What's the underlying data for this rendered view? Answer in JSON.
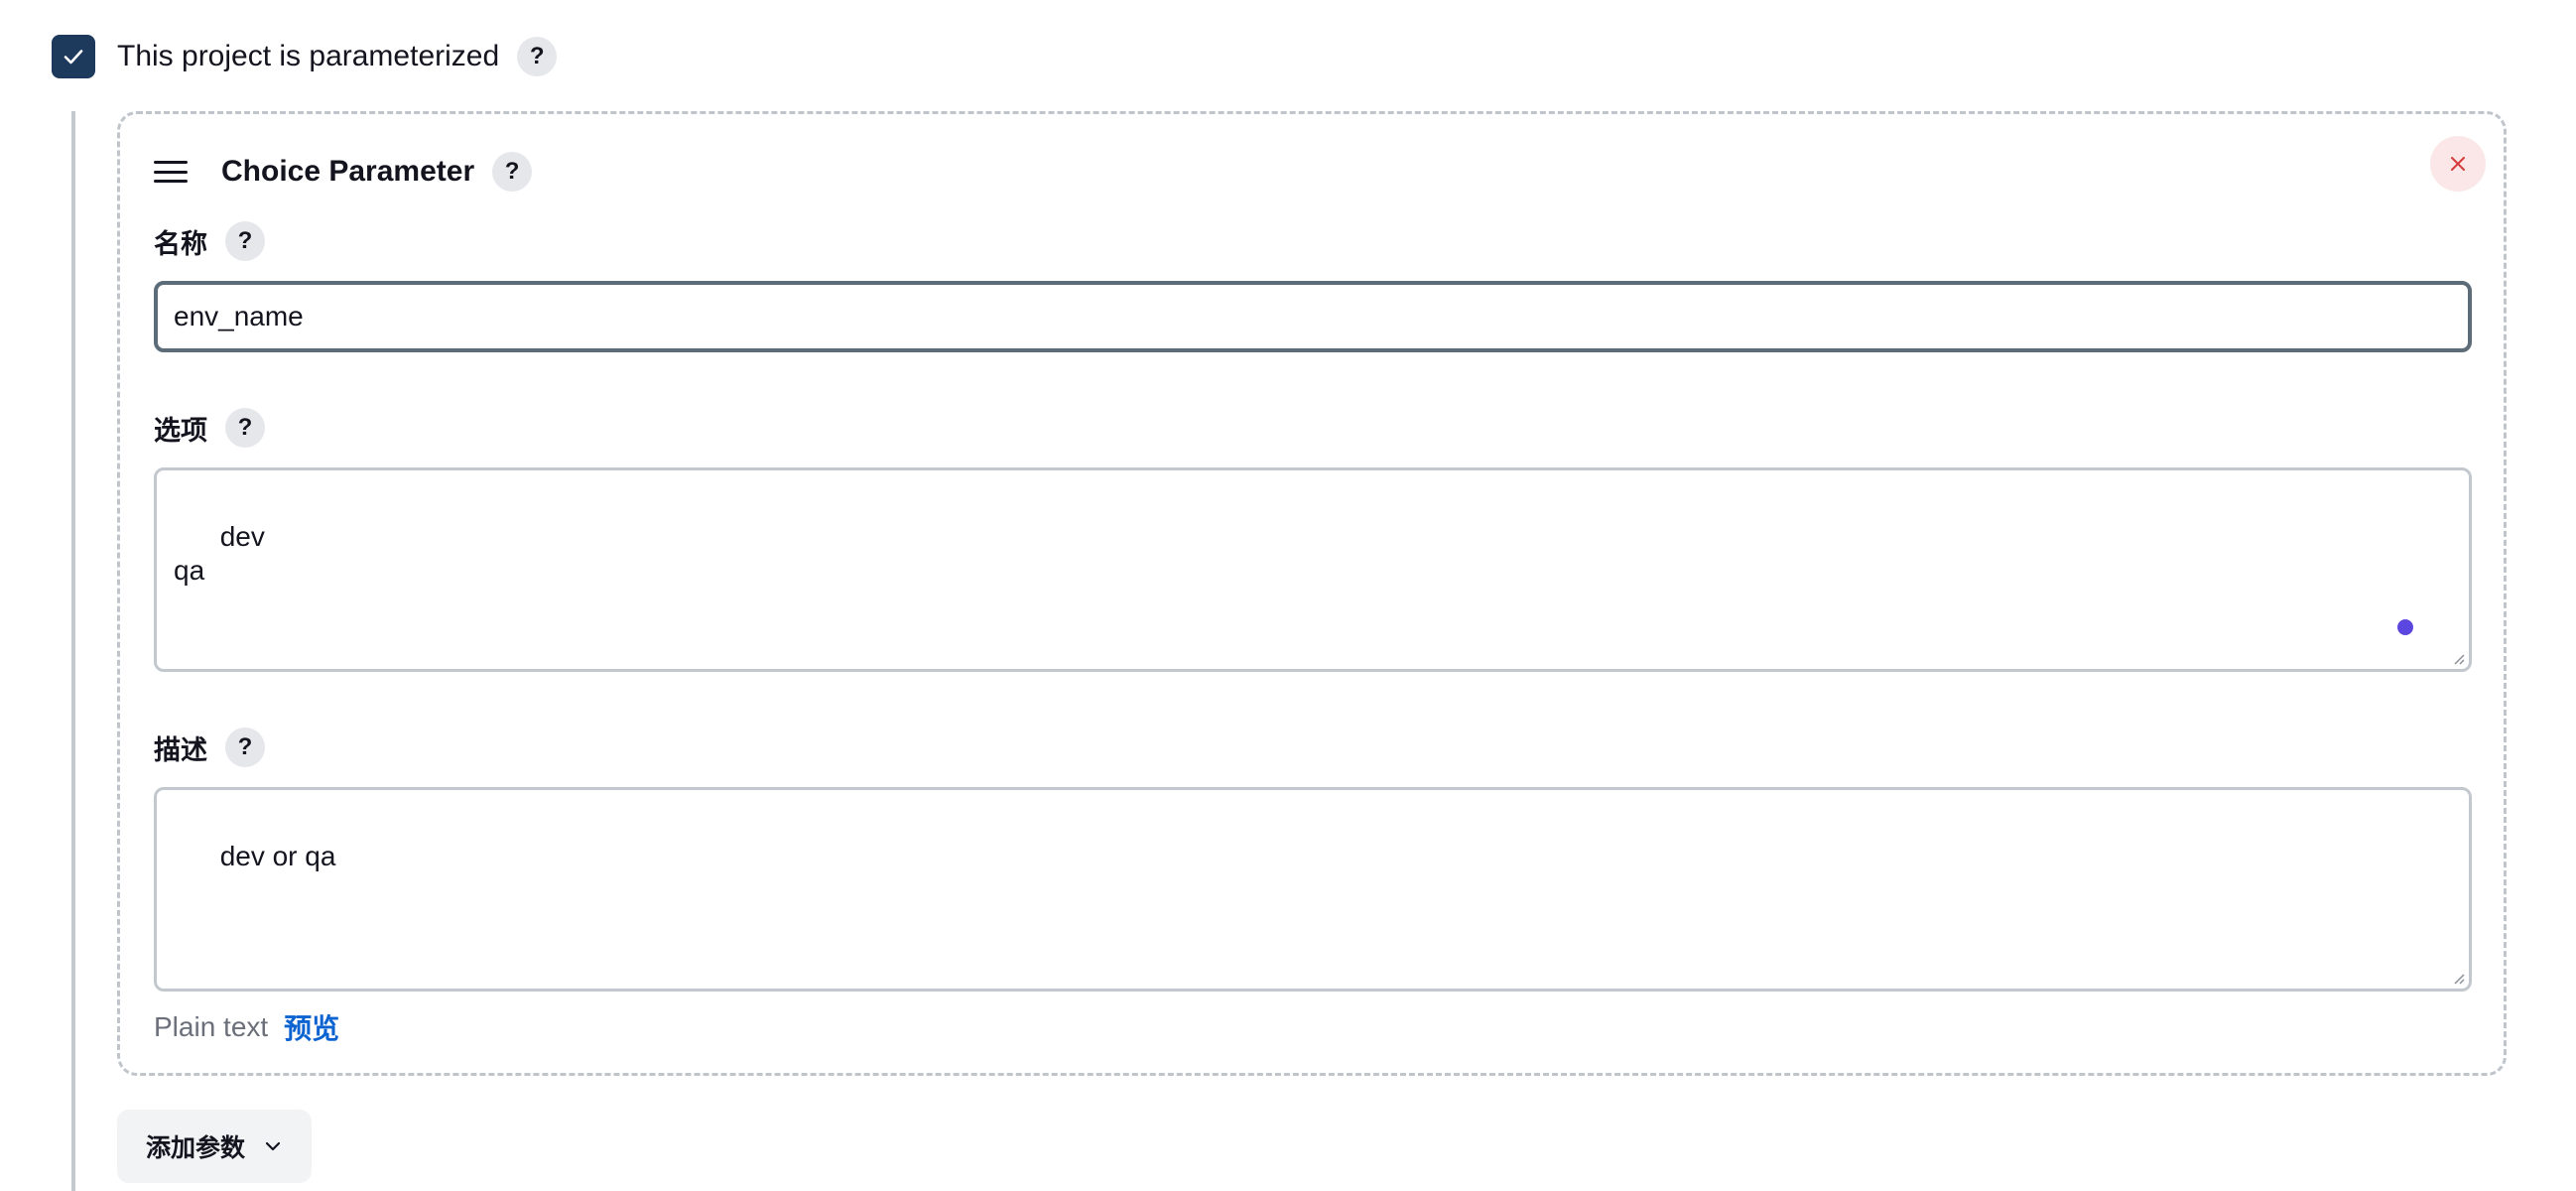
{
  "parameterized": {
    "label": "This project is parameterized",
    "checked": true,
    "help": "?"
  },
  "card": {
    "title": "Choice Parameter",
    "help": "?",
    "icons": {
      "drag": "drag-handle-icon",
      "close": "close-icon"
    }
  },
  "fields": {
    "name": {
      "label": "名称",
      "help": "?",
      "value": "env_name"
    },
    "choices": {
      "label": "选项",
      "help": "?",
      "value": "dev\nqa"
    },
    "description": {
      "label": "描述",
      "help": "?",
      "value": "dev or qa"
    }
  },
  "format": {
    "plain_text": "Plain text",
    "preview": "预览"
  },
  "add_param": {
    "label": "添加参数",
    "icon": "chevron-down-icon"
  },
  "colors": {
    "checkbox": "#1d3a5c",
    "link": "#0b63d1",
    "close_bg": "#fbe7e7",
    "close_icon": "#d63c3c"
  }
}
